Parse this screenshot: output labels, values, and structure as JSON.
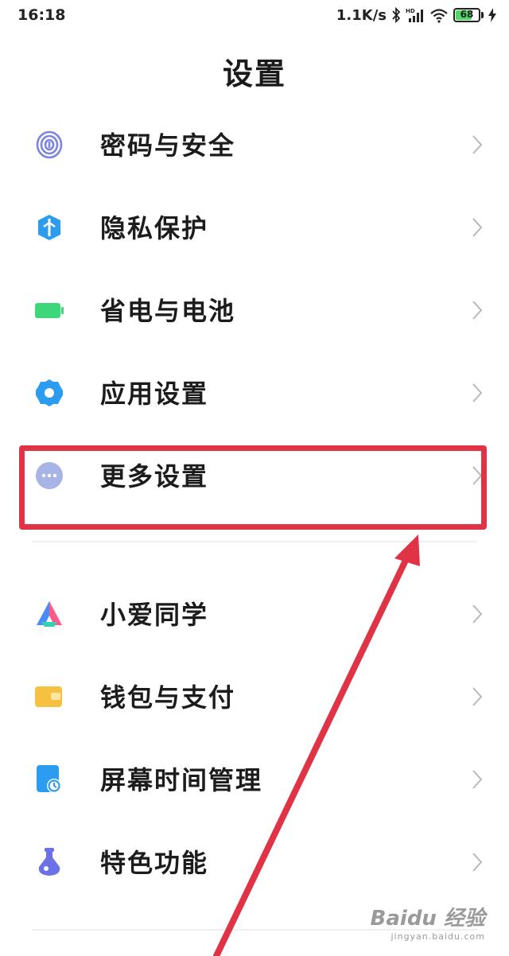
{
  "status_bar": {
    "time": "16:18",
    "net_speed": "1.1K/s",
    "battery_level": "68"
  },
  "page": {
    "title": "设置"
  },
  "group1": [
    {
      "label": "密码与安全",
      "icon": "fingerprint-icon"
    },
    {
      "label": "隐私保护",
      "icon": "privacy-shield-icon"
    },
    {
      "label": "省电与电池",
      "icon": "battery-icon"
    },
    {
      "label": "应用设置",
      "icon": "gear-icon"
    },
    {
      "label": "更多设置",
      "icon": "more-dots-icon"
    }
  ],
  "group2": [
    {
      "label": "小爱同学",
      "icon": "xiaoai-icon"
    },
    {
      "label": "钱包与支付",
      "icon": "wallet-icon"
    },
    {
      "label": "屏幕时间管理",
      "icon": "screen-time-icon"
    },
    {
      "label": "特色功能",
      "icon": "flask-icon"
    }
  ],
  "annotation": {
    "highlight_color": "#e03345"
  },
  "watermark": {
    "main": "Baidu 经验",
    "sub": "jingyan.baidu.com"
  },
  "colors": {
    "fingerprint": "#7b84e0",
    "privacy": "#2c9cf0",
    "battery": "#3ed67a",
    "gear": "#2c9cf0",
    "more": "#a9b4e6",
    "wallet": "#f6c140",
    "screen_time": "#2c9cf0",
    "flask": "#6d71e8"
  }
}
